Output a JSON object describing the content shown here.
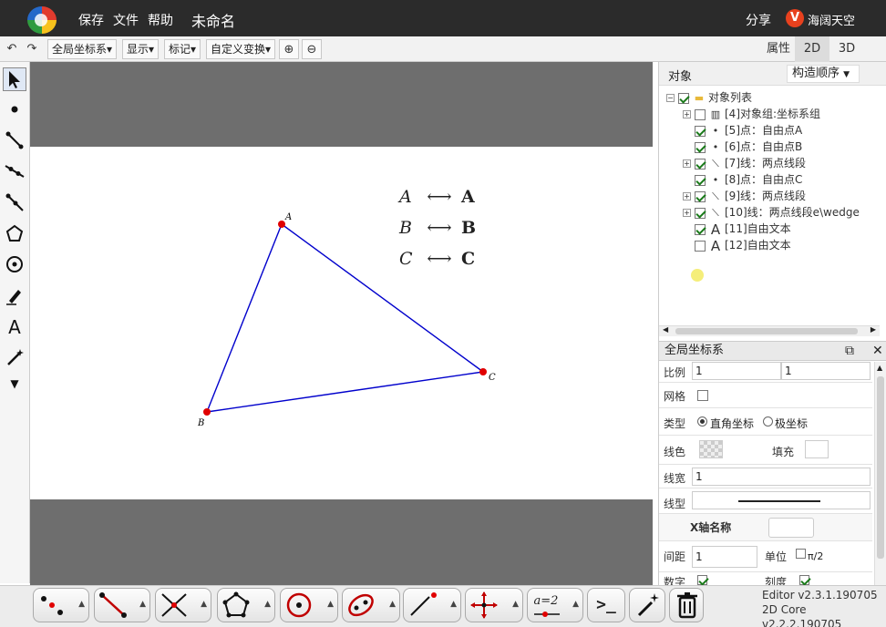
{
  "topbar": {
    "menu": [
      "保存",
      "文件",
      "帮助"
    ],
    "doc_title": "未命名",
    "share": "分享",
    "user_badge": "V",
    "username": "海阔天空"
  },
  "toolbar": {
    "buttons": [
      "全局坐标系▾",
      "显示▾",
      "标记▾",
      "自定义变换▾"
    ],
    "tabs": [
      "属性",
      "2D",
      "3D"
    ],
    "active_tab": "2D"
  },
  "canvas": {
    "points": [
      {
        "label": "A",
        "color": "#e00000"
      },
      {
        "label": "B",
        "color": "#e00000"
      },
      {
        "label": "C",
        "color": "#e00000"
      }
    ],
    "line_color": "#0000cc",
    "text_lines": [
      {
        "italic": "A",
        "arrow": "⟷",
        "bold": "A"
      },
      {
        "italic": "B",
        "arrow": "⟷",
        "bold": "B"
      },
      {
        "italic": "C",
        "arrow": "⟷",
        "bold": "C"
      }
    ]
  },
  "object_panel": {
    "title": "对象",
    "sort_label": "构造顺序",
    "root": "对象列表",
    "items": [
      {
        "text": "[4]对象组:坐标系组",
        "checked": false,
        "expander": true,
        "icon": "chart-icon"
      },
      {
        "text": "[5]点：自由点A",
        "checked": true,
        "expander": false,
        "icon": "point-icon"
      },
      {
        "text": "[6]点：自由点B",
        "checked": true,
        "expander": false,
        "icon": "point-icon"
      },
      {
        "text": "[7]线：两点线段",
        "checked": true,
        "expander": true,
        "icon": "segment-icon"
      },
      {
        "text": "[8]点：自由点C",
        "checked": true,
        "expander": false,
        "icon": "point-icon"
      },
      {
        "text": "[9]线：两点线段",
        "checked": true,
        "expander": true,
        "icon": "segment-icon"
      },
      {
        "text": "[10]线：两点线段e\\wedge",
        "checked": true,
        "expander": true,
        "icon": "segment-icon"
      },
      {
        "text": "[11]自由文本",
        "checked": true,
        "expander": false,
        "icon": "text-icon"
      },
      {
        "text": "[12]自由文本",
        "checked": false,
        "expander": false,
        "icon": "text-icon"
      }
    ]
  },
  "properties": {
    "title": "全局坐标系",
    "scale_label": "比例",
    "scale_x": "1",
    "scale_y": "1",
    "grid_label": "网格",
    "type_label": "类型",
    "type_option1": "直角坐标",
    "type_option2": "极坐标",
    "line_color_label": "线色",
    "fill_label": "填充",
    "line_width_label": "线宽",
    "line_width_value": "1",
    "line_type_label": "线型",
    "x_axis_name_label": "X轴名称",
    "spacing_label": "间距",
    "spacing_value": "1",
    "unit_label": "单位",
    "unit_value": "π/2",
    "number_label": "数字",
    "tick_label": "刻度"
  },
  "bottombar": {
    "formula_label": "a=2",
    "version_editor": "Editor v2.3.1.190705",
    "version_core": "2D Core v2.2.2.190705"
  }
}
